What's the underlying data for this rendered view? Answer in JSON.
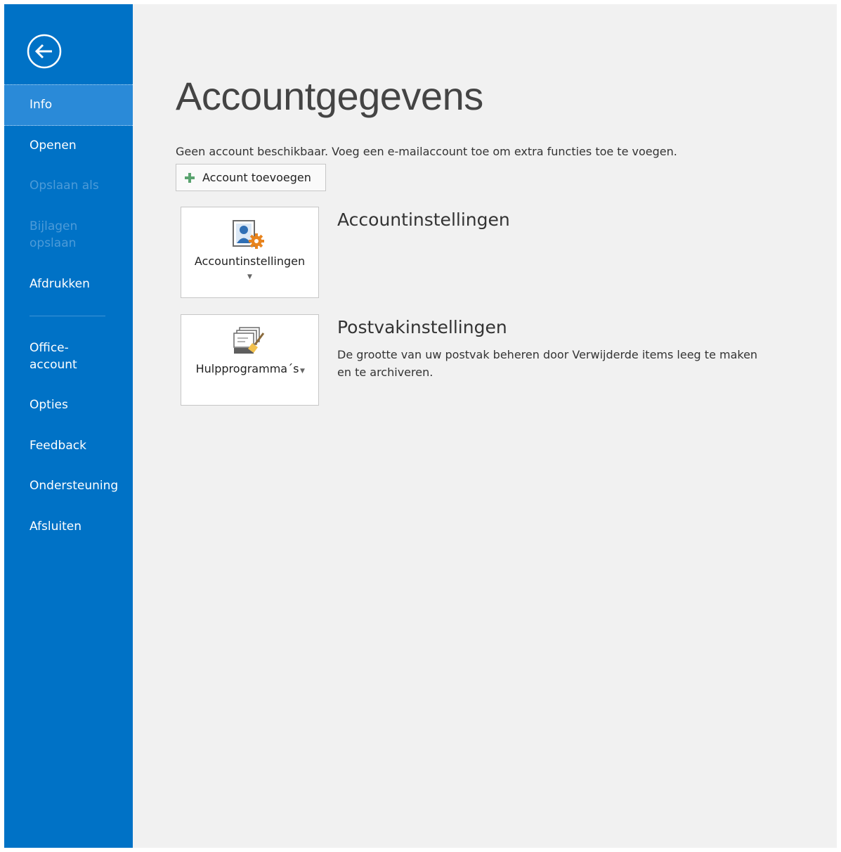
{
  "sidebar": {
    "back_icon": "back-arrow-circle-icon",
    "items": [
      {
        "label": "Info"
      },
      {
        "label": "Openen"
      },
      {
        "label": "Opslaan als"
      },
      {
        "label": "Bijlagen opslaan"
      },
      {
        "label": "Afdrukken"
      },
      {
        "label": "Office-account"
      },
      {
        "label": "Opties"
      },
      {
        "label": "Feedback"
      },
      {
        "label": "Ondersteuning"
      },
      {
        "label": "Afsluiten"
      }
    ]
  },
  "main": {
    "title": "Accountgegevens",
    "intro": "Geen account beschikbaar. Voeg een e-mailaccount toe om extra functies toe te voegen.",
    "add_account_label": "Account toevoegen",
    "account_settings": {
      "tile_label": "Accountinstellingen",
      "section_title": "Accountinstellingen",
      "icon": "account-settings-icon"
    },
    "mailbox": {
      "tile_label": "Hulpprogramma´s",
      "section_title": "Postvakinstellingen",
      "description": "De grootte van uw postvak beheren door Verwijderde items leeg te maken en te archiveren.",
      "icon": "mailbox-cleanup-icon"
    }
  },
  "colors": {
    "sidebar": "#0072c6",
    "sidebar_selected": "#2a8ad8",
    "background": "#f1f1f1",
    "plus_icon": "#5aa36f",
    "gear_icon": "#e8841e"
  }
}
